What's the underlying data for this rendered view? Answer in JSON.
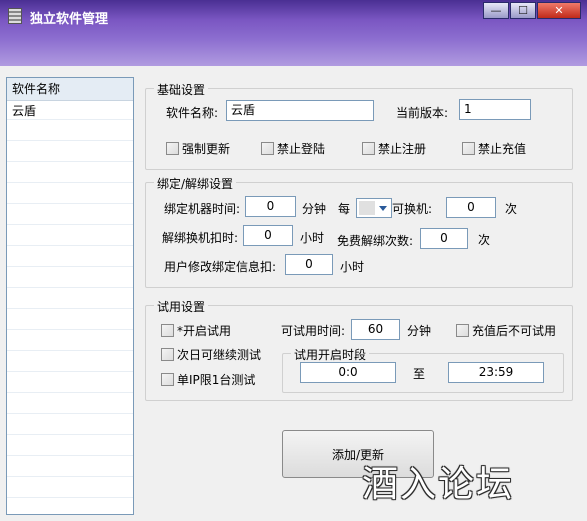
{
  "window": {
    "title": "独立软件管理",
    "minimize": "—",
    "maximize": "☐",
    "close": "✕"
  },
  "sidebar": {
    "header": "软件名称",
    "items": [
      "云盾"
    ]
  },
  "basic": {
    "title": "基础设置",
    "name_label": "软件名称:",
    "name_value": "云盾",
    "version_label": "当前版本:",
    "version_value": "1",
    "checks": [
      "强制更新",
      "禁止登陆",
      "禁止注册",
      "禁止充值"
    ]
  },
  "bind": {
    "title": "绑定/解绑设置",
    "bind_time_label": "绑定机器时间:",
    "bind_time_value": "0",
    "minute_unit": "分钟",
    "per_label": "每",
    "switch_label": "可换机:",
    "switch_value": "0",
    "times_unit": "次",
    "unbind_deduct_label": "解绑换机扣时:",
    "unbind_deduct_value": "0",
    "hour_unit": "小时",
    "free_unbind_label": "免费解绑次数:",
    "free_unbind_value": "0",
    "free_unbind_unit": "次",
    "modify_label": "用户修改绑定信息扣:",
    "modify_value": "0",
    "modify_unit": "小时"
  },
  "trial": {
    "title": "试用设置",
    "enable_trial": "*开启试用",
    "next_day": "次日可继续测试",
    "single_ip": "单IP限1台测试",
    "trial_time_label": "可试用时间:",
    "trial_time_value": "60",
    "trial_time_unit": "分钟",
    "no_trial_after_recharge": "充值后不可试用",
    "period_title": "试用开启时段",
    "period_start": "0:0",
    "period_to": "至",
    "period_end": "23:59"
  },
  "actions": {
    "add_update": "添加/更新"
  },
  "watermark": "酒入论坛"
}
